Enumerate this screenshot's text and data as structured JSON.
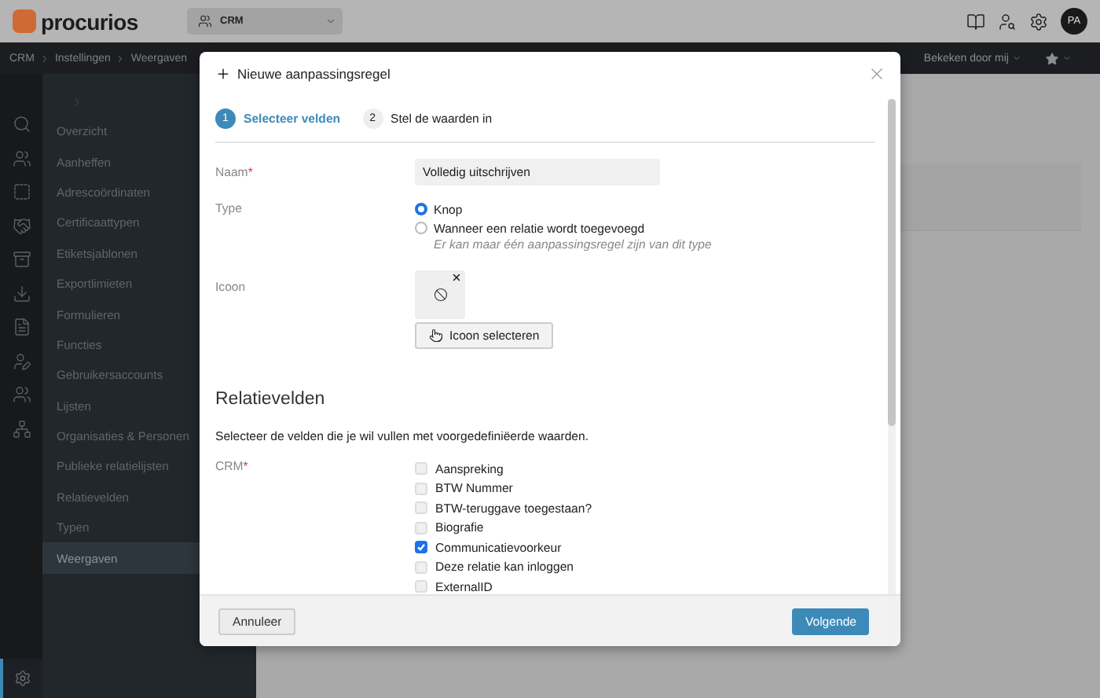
{
  "topbar": {
    "logo": "procurios",
    "app_switcher": "CRM",
    "avatar": "PA"
  },
  "breadcrumb": {
    "items": [
      "CRM",
      "Instellingen",
      "Weergaven"
    ],
    "viewed_filter": "Bekeken door mij"
  },
  "sidebar": {
    "items": [
      {
        "label": "Overzicht",
        "selected": false
      },
      {
        "label": "Aanheffen",
        "selected": false
      },
      {
        "label": "Adrescoördinaten",
        "selected": false
      },
      {
        "label": "Certificaattypen",
        "selected": false
      },
      {
        "label": "Etiketsjablonen",
        "selected": false
      },
      {
        "label": "Exportlimieten",
        "selected": false
      },
      {
        "label": "Formulieren",
        "selected": false
      },
      {
        "label": "Functies",
        "selected": false
      },
      {
        "label": "Gebruikersaccounts",
        "selected": false
      },
      {
        "label": "Lijsten",
        "selected": false
      },
      {
        "label": "Organisaties & Personen",
        "selected": false
      },
      {
        "label": "Publieke relatielijsten",
        "selected": false
      },
      {
        "label": "Relatievelden",
        "selected": false
      },
      {
        "label": "Typen",
        "selected": false
      },
      {
        "label": "Weergaven",
        "selected": true
      }
    ]
  },
  "dialog": {
    "title": "Nieuwe aanpassingsregel",
    "steps": [
      {
        "number": "1",
        "label": "Selecteer velden",
        "selected": true
      },
      {
        "number": "2",
        "label": "Stel de waarden in",
        "selected": false
      }
    ],
    "name": {
      "label": "Naam",
      "required_mark": "*",
      "value": "Volledig uitschrijven"
    },
    "type": {
      "label": "Type",
      "options": [
        {
          "label": "Knop",
          "selected": true
        },
        {
          "label": "Wanneer een relatie wordt toegevoegd",
          "selected": false
        }
      ],
      "hint": "Er kan maar één aanpassingsregel zijn van dit type"
    },
    "icon": {
      "label": "Icoon",
      "button": "Icoon selecteren"
    },
    "section_title": "Relatievelden",
    "section_description": "Selecteer de velden die je wil vullen met voorgedefiniëerde waarden.",
    "crm": {
      "label": "CRM",
      "required_mark": "*",
      "fields": [
        {
          "label": "Aanspreking",
          "checked": false
        },
        {
          "label": "BTW Nummer",
          "checked": false
        },
        {
          "label": "BTW-teruggave toegestaan?",
          "checked": false
        },
        {
          "label": "Biografie",
          "checked": false
        },
        {
          "label": "Communicatievoorkeur",
          "checked": true
        },
        {
          "label": "Deze relatie kan inloggen",
          "checked": false
        },
        {
          "label": "ExternalID",
          "checked": false
        }
      ]
    },
    "buttons": {
      "cancel": "Annuleer",
      "next": "Volgende"
    }
  }
}
